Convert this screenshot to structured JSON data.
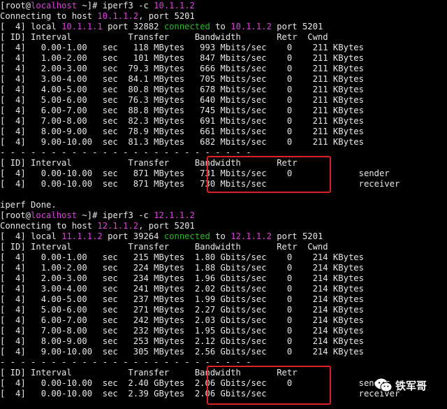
{
  "session1": {
    "prompt": "[root@localhost ~]# ",
    "prompt_parts": {
      "open": "[root@",
      "host": "localhost",
      "close": " ~]# "
    },
    "command": "iperf3 -c ",
    "command_ip": "10.1.1.2",
    "connecting_prefix": "Connecting to host ",
    "connecting_ip": "10.1.1.2",
    "connecting_suffix": ", port 5201",
    "local_prefix": "[  4] local ",
    "local_ip": "10.1.1.1",
    "local_port_text": " port 32882 ",
    "connected_word": "connected",
    "to_word": " to ",
    "remote_ip": "10.1.1.2",
    "remote_port_text": " port 5201",
    "header": "[ ID] Interval           Transfer     Bandwidth       Retr  Cwnd",
    "rows": [
      "[  4]   0.00-1.00   sec   118 MBytes   993 Mbits/sec    0    211 KBytes",
      "[  4]   1.00-2.00   sec   101 MBytes   847 Mbits/sec    0    211 KBytes",
      "[  4]   2.00-3.00   sec  79.3 MBytes   666 Mbits/sec    0    211 KBytes",
      "[  4]   3.00-4.00   sec  84.1 MBytes   705 Mbits/sec    0    211 KBytes",
      "[  4]   4.00-5.00   sec  80.8 MBytes   678 Mbits/sec    0    211 KBytes",
      "[  4]   5.00-6.00   sec  76.3 MBytes   640 Mbits/sec    0    211 KBytes",
      "[  4]   6.00-7.00   sec  88.8 MBytes   745 Mbits/sec    0    211 KBytes",
      "[  4]   7.00-8.00   sec  82.3 MBytes   691 Mbits/sec    0    211 KBytes",
      "[  4]   8.00-9.00   sec  78.9 MBytes   661 Mbits/sec    0    211 KBytes",
      "[  4]   9.00-10.00  sec  81.3 MBytes   682 Mbits/sec    0    211 KBytes"
    ],
    "separator": "- - - - - - - - - - - - - - - - - - - - - - - - -",
    "summary_header": "[ ID] Interval           Transfer     Bandwidth       Retr",
    "summary_rows": [
      "[  4]   0.00-10.00  sec   871 MBytes   731 Mbits/sec    0             sender",
      "[  4]   0.00-10.00  sec   871 MBytes   730 Mbits/sec                  receiver"
    ],
    "done": "iperf Done."
  },
  "session2": {
    "prompt_parts": {
      "open": "[root@",
      "host": "localhost",
      "close": " ~]# "
    },
    "command": "iperf3 -c ",
    "command_ip": "12.1.1.2",
    "connecting_prefix": "Connecting to host ",
    "connecting_ip": "12.1.1.2",
    "connecting_suffix": ", port 5201",
    "local_prefix": "[  4] local ",
    "local_ip": "11.1.1.2",
    "local_port_text": " port 39264 ",
    "connected_word": "connected",
    "to_word": " to ",
    "remote_ip": "12.1.1.2",
    "remote_port_text": " port 5201",
    "header": "[ ID] Interval           Transfer     Bandwidth       Retr  Cwnd",
    "rows": [
      "[  4]   0.00-1.00   sec   215 MBytes  1.80 Gbits/sec    0    214 KBytes",
      "[  4]   1.00-2.00   sec   224 MBytes  1.88 Gbits/sec    0    214 KBytes",
      "[  4]   2.00-3.00   sec   234 MBytes  1.96 Gbits/sec    0    214 KBytes",
      "[  4]   3.00-4.00   sec   241 MBytes  2.02 Gbits/sec    0    214 KBytes",
      "[  4]   4.00-5.00   sec   237 MBytes  1.99 Gbits/sec    0    214 KBytes",
      "[  4]   5.00-6.00   sec   271 MBytes  2.27 Gbits/sec    0    214 KBytes",
      "[  4]   6.00-7.00   sec   242 MBytes  2.03 Gbits/sec    0    214 KBytes",
      "[  4]   7.00-8.00   sec   232 MBytes  1.95 Gbits/sec    0    214 KBytes",
      "[  4]   8.00-9.00   sec   253 MBytes  2.12 Gbits/sec    0    214 KBytes",
      "[  4]   9.00-10.00  sec   305 MBytes  2.56 Gbits/sec    0    214 KBytes"
    ],
    "separator": "- - - - - - - - - - - - - - - - - - - - - - - - -",
    "summary_header": "[ ID] Interval           Transfer     Bandwidth       Retr",
    "summary_rows": [
      "[  4]   0.00-10.00  sec  2.40 GBytes  2.06 Gbits/sec    0             sender",
      "[  4]   0.00-10.00  sec  2.39 GBytes  2.06 Gbits/sec                  receiver"
    ]
  },
  "watermark": {
    "text": "铁军哥",
    "icon": "wechat-icon"
  },
  "colors": {
    "background": "#000000",
    "text": "#e8e8e8",
    "ip": "#e040e0",
    "connected": "#20c020",
    "highlight": "#e02020"
  }
}
